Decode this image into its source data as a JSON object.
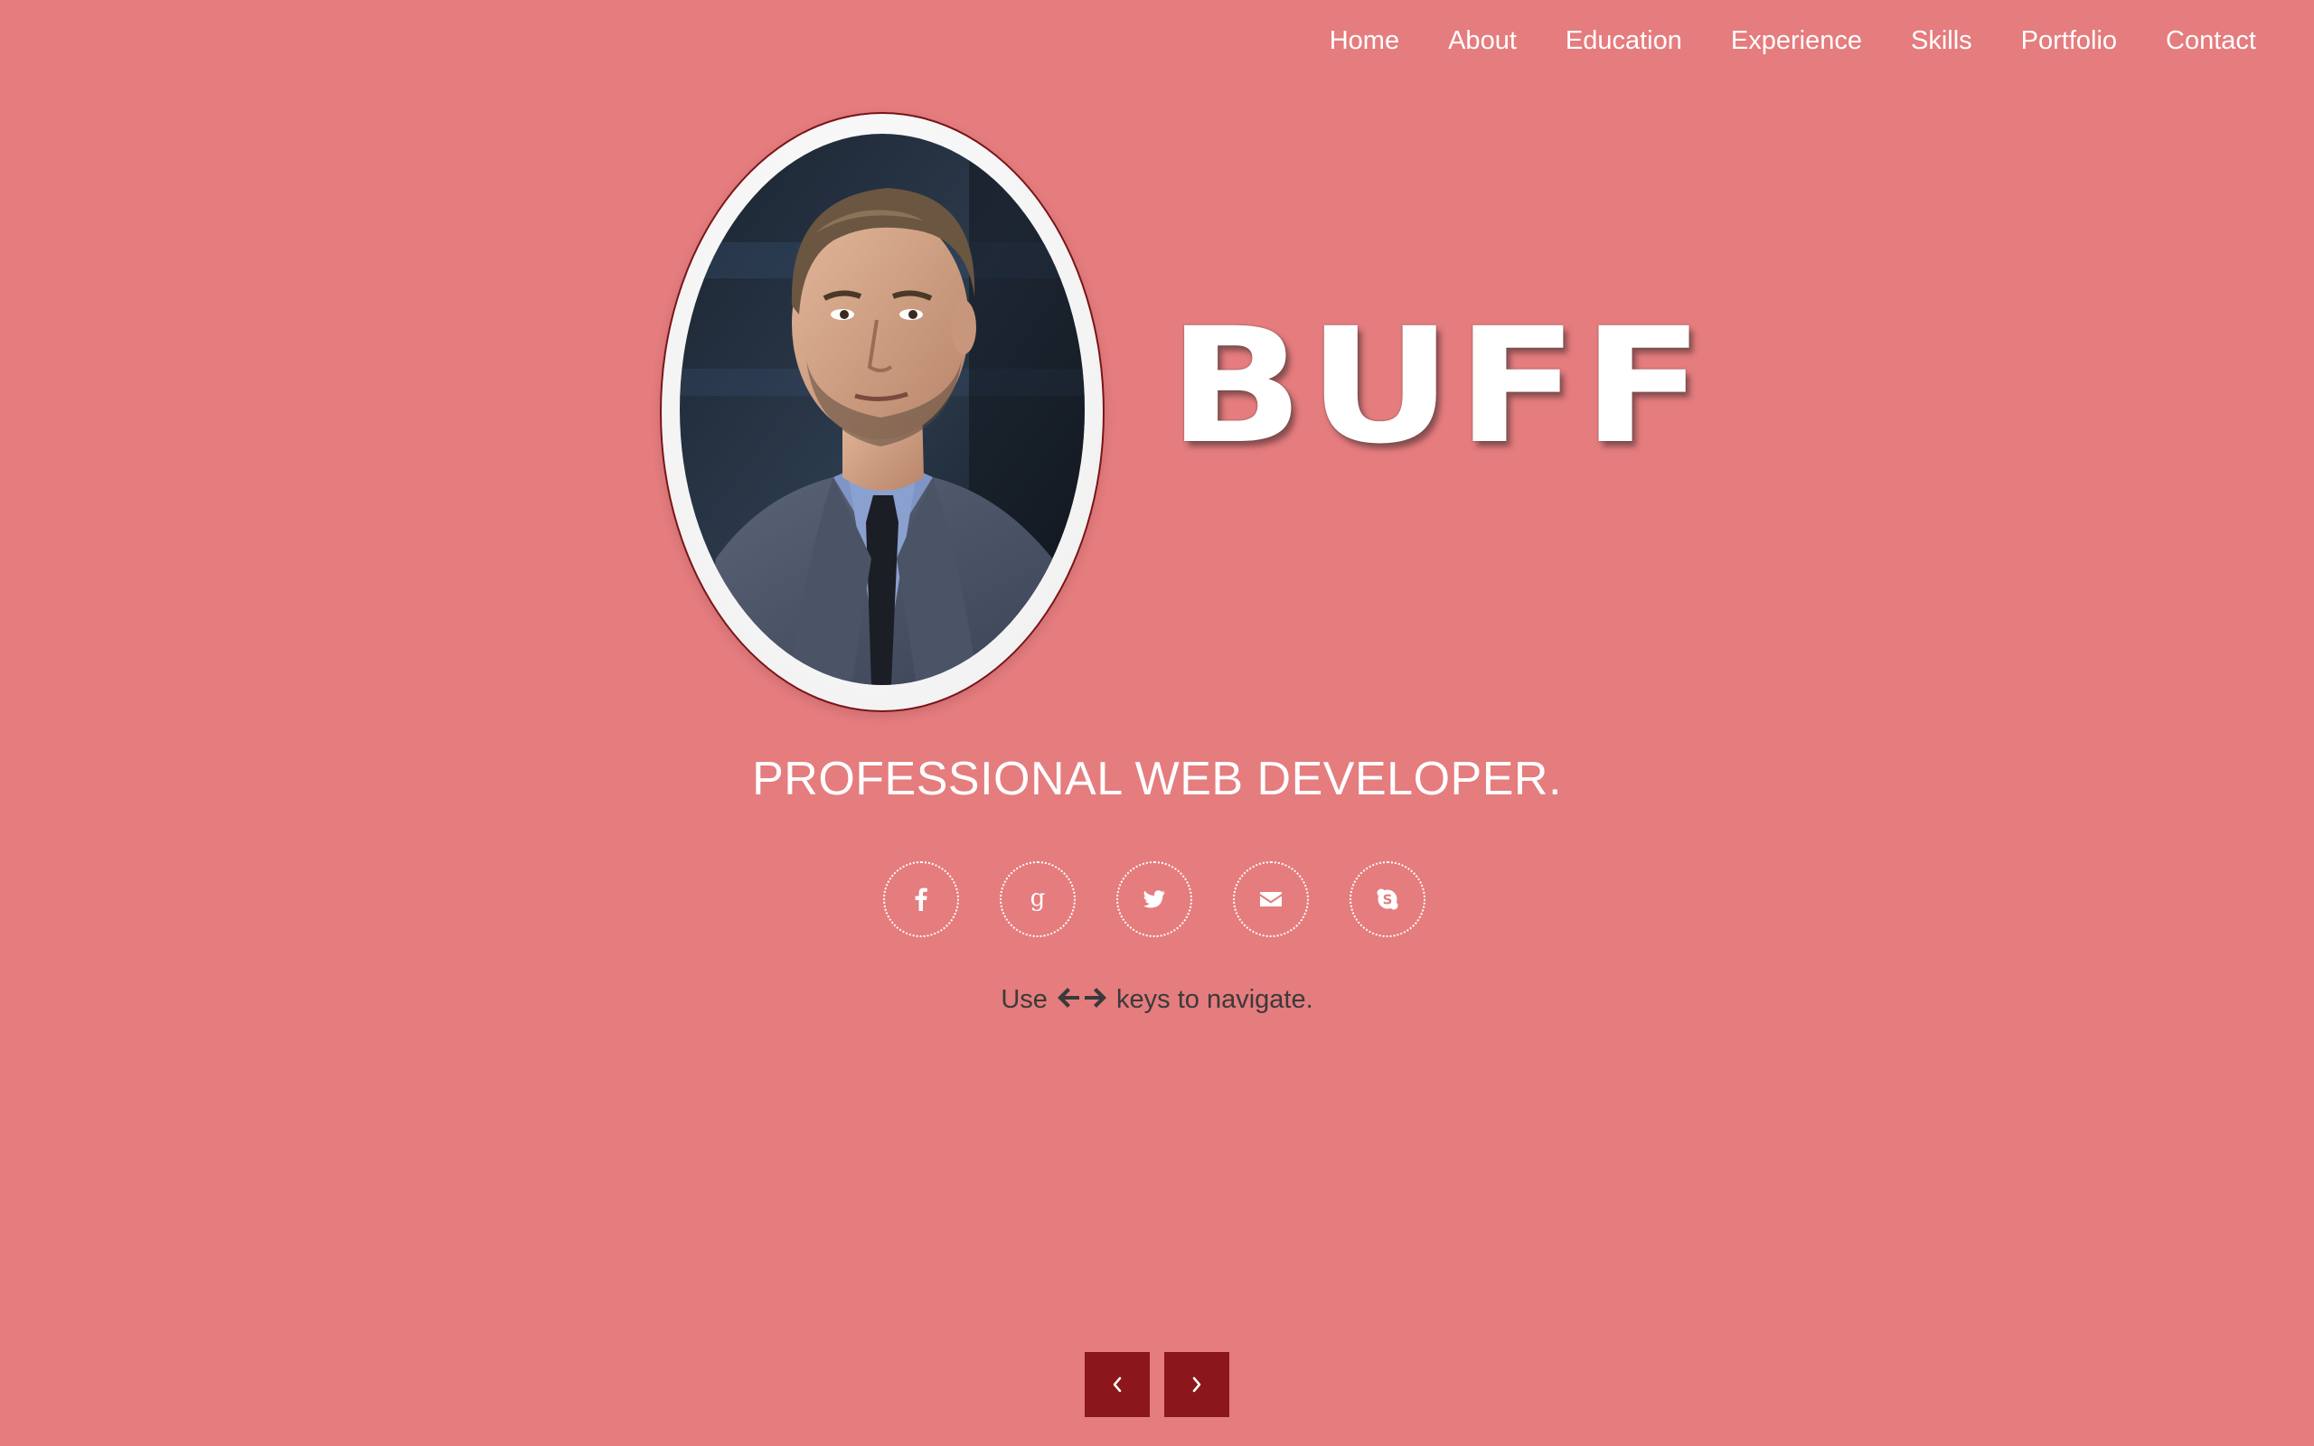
{
  "colors": {
    "background": "#e57c7e",
    "pager_button": "#8b171b",
    "text_primary": "#ffffff",
    "hint_text": "#3a3a3a"
  },
  "nav": {
    "items": [
      {
        "label": "Home"
      },
      {
        "label": "About"
      },
      {
        "label": "Education"
      },
      {
        "label": "Experience"
      },
      {
        "label": "Skills"
      },
      {
        "label": "Portfolio"
      },
      {
        "label": "Contact"
      }
    ]
  },
  "hero": {
    "photo_alt": "profile-photo",
    "name": "BUFF",
    "tagline": "PROFESSIONAL WEB DEVELOPER."
  },
  "social": [
    {
      "icon": "facebook-icon"
    },
    {
      "icon": "google-plus-icon"
    },
    {
      "icon": "twitter-icon"
    },
    {
      "icon": "email-icon"
    },
    {
      "icon": "skype-icon"
    }
  ],
  "hint": {
    "prefix": "Use",
    "suffix": "keys to navigate."
  },
  "pager": {
    "prev_icon": "chevron-left-icon",
    "next_icon": "chevron-right-icon"
  }
}
